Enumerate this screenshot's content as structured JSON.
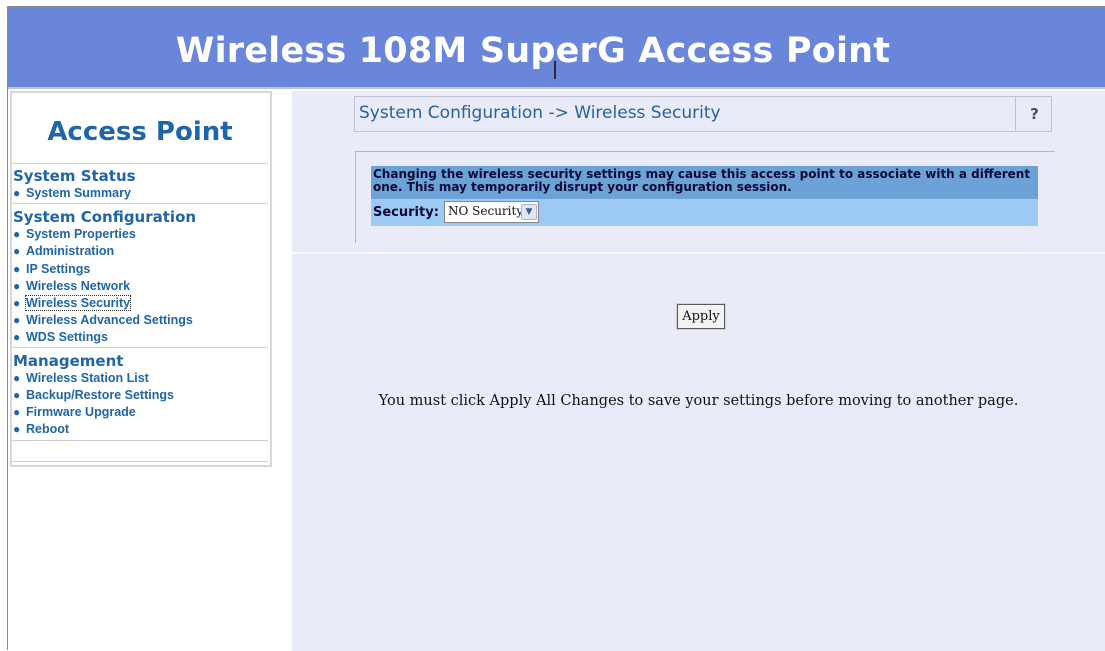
{
  "banner": {
    "title": "Wireless 108M SuperG Access Point"
  },
  "sidebar": {
    "title": "Access Point",
    "sections": [
      {
        "heading": "System Status",
        "items": [
          "System Summary"
        ]
      },
      {
        "heading": "System Configuration",
        "items": [
          "System Properties",
          "Administration",
          "IP Settings",
          "Wireless Network",
          "Wireless Security",
          "Wireless Advanced Settings",
          "WDS Settings"
        ]
      },
      {
        "heading": "Management",
        "items": [
          "Wireless Station List",
          "Backup/Restore Settings",
          "Firmware Upgrade",
          "Reboot"
        ]
      }
    ],
    "active_item": "Wireless Security"
  },
  "main": {
    "breadcrumb": "System Configuration -> Wireless Security",
    "help_label": "?",
    "warning_text": "Changing the wireless security settings may cause this access point to associate with a different one. This may temporarily disrupt your configuration session.",
    "security_label": "Security:",
    "security_value": "NO Security",
    "apply_label": "Apply",
    "note": "You must click Apply All Changes to save your settings before moving to another page."
  },
  "colors": {
    "banner_bg": "#6a86da",
    "nav_text": "#1f65a8",
    "main_bg": "#e9ecf8",
    "warning_bg": "#6da2d8",
    "security_row_bg": "#9ccaf4"
  },
  "icons": {
    "select_arrow": "chevron-down-icon",
    "help": "help-icon"
  }
}
